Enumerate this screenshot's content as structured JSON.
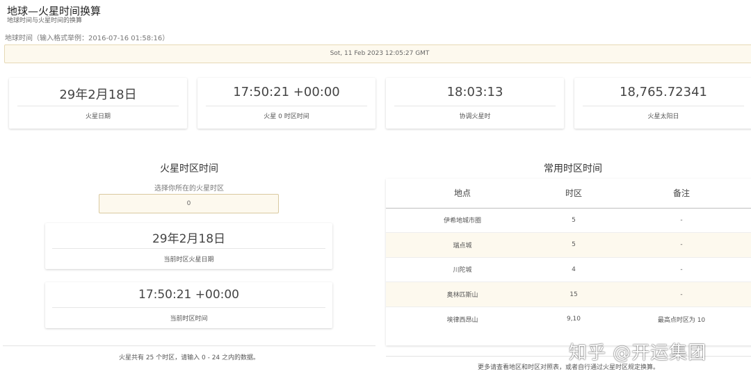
{
  "header": {
    "title": "地球—火星时间换算",
    "subtitle": "地球时间与火星时间的换算"
  },
  "earth_time": {
    "label": "地球时间（输入格式举例：2016-07-16 01:58:16）",
    "value": "Sot, 11 Feb 2023 12:05:27 GMT"
  },
  "stats": [
    {
      "value": "29年2月18日",
      "label": "火星日期"
    },
    {
      "value": "17:50:21 +00:00",
      "label": "火星 0 时区时间"
    },
    {
      "value": "18:03:13",
      "label": "协调火星时"
    },
    {
      "value": "18,765.72341",
      "label": "火星太阳日"
    }
  ],
  "mars_zone": {
    "title": "火星时区时间",
    "select_label": "选择你所在的火星时区",
    "input_value": "0",
    "date_value": "29年2月18日",
    "date_caption": "当前时区火星日期",
    "time_value": "17:50:21 +00:00",
    "time_caption": "当前时区时间",
    "footnote": "火星共有 25 个时区，请输入 0 - 24 之内的数据。"
  },
  "common_zones": {
    "title": "常用时区时间",
    "headers": [
      "地点",
      "时区",
      "备注"
    ],
    "rows": [
      {
        "place": "伊希地城市圈",
        "zone": "5",
        "note": "-"
      },
      {
        "place": "瑞点城",
        "zone": "5",
        "note": "-"
      },
      {
        "place": "川陀城",
        "zone": "4",
        "note": "-"
      },
      {
        "place": "奥林匹斯山",
        "zone": "15",
        "note": "-"
      },
      {
        "place": "埃律西昂山",
        "zone": "9,10",
        "note": "最高点时区为 10"
      }
    ],
    "footnote": "更多请查看地区和时区对照表，或者自行通过火星时区规定换算。"
  },
  "watermark": "知乎 @开运集团"
}
